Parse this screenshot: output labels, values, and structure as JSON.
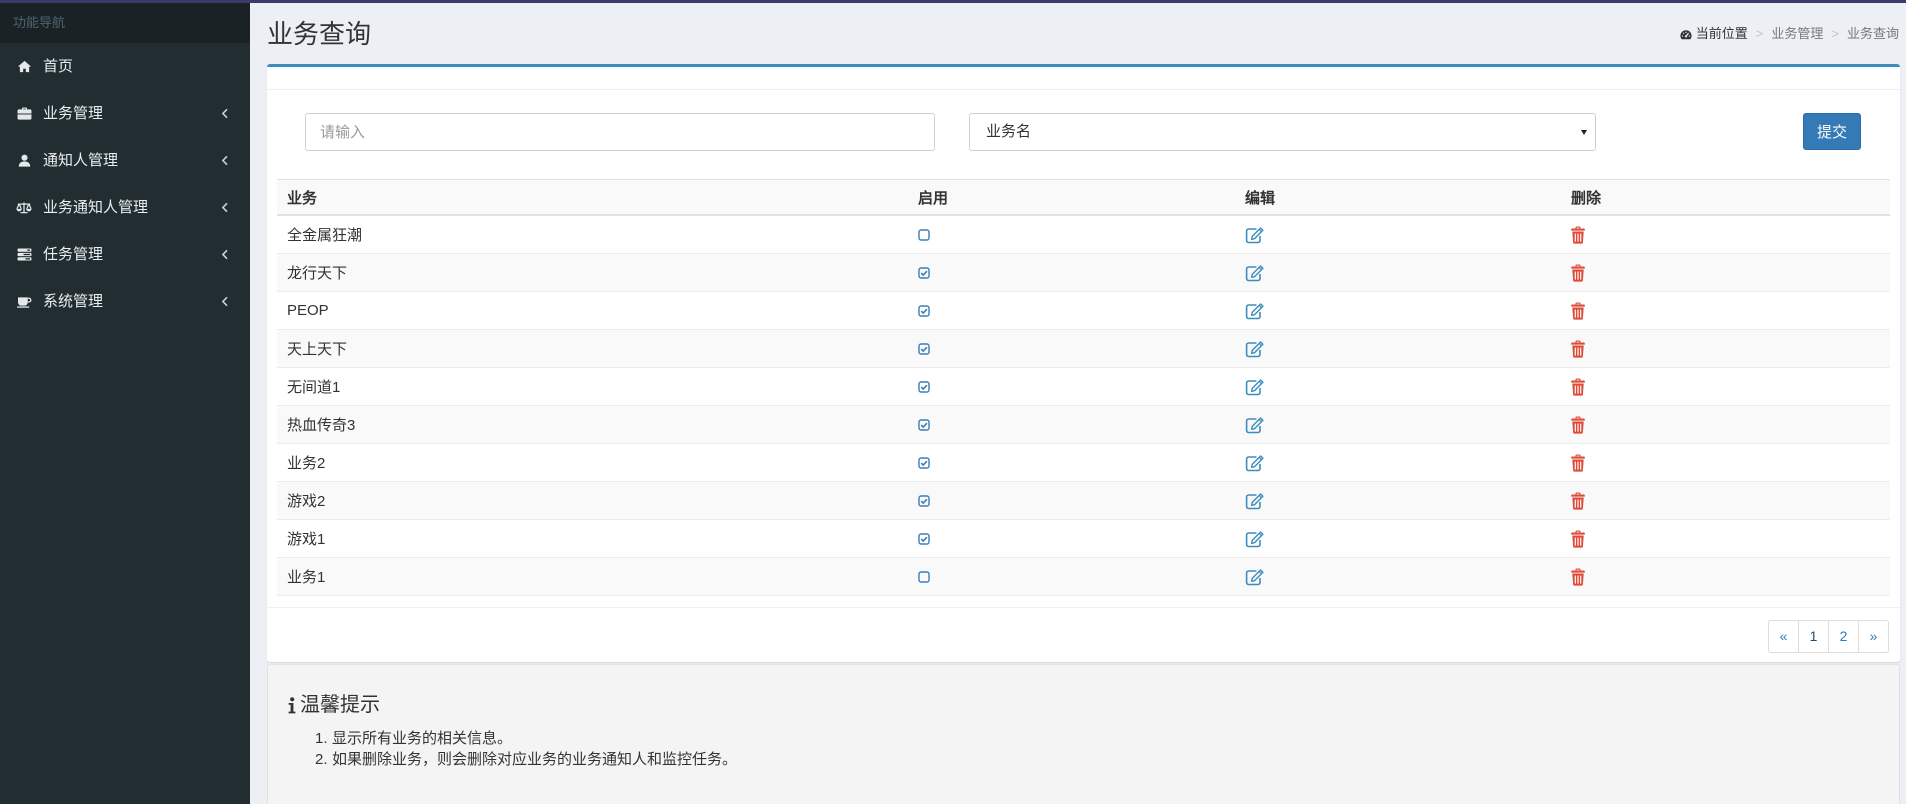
{
  "colors": {
    "top_bar": "#3b3a6e",
    "sidebar_bg": "#222d32",
    "sidebar_header_bg": "#1a2226",
    "main_bg": "#ecf0f5",
    "accent": "#3c8dbc",
    "primary_button": "#337ab7",
    "danger": "#dd4b39"
  },
  "sidebar": {
    "header": "功能导航",
    "items": [
      {
        "label": "首页",
        "icon": "home-icon",
        "has_submenu": false
      },
      {
        "label": "业务管理",
        "icon": "briefcase-icon",
        "has_submenu": true
      },
      {
        "label": "通知人管理",
        "icon": "user-icon",
        "has_submenu": true
      },
      {
        "label": "业务通知人管理",
        "icon": "balance-scale-icon",
        "has_submenu": true
      },
      {
        "label": "任务管理",
        "icon": "tasks-icon",
        "has_submenu": true
      },
      {
        "label": "系统管理",
        "icon": "coffee-icon",
        "has_submenu": true
      }
    ]
  },
  "page": {
    "title": "业务查询"
  },
  "breadcrumb": {
    "icon": "dashboard-icon",
    "separator": ">",
    "items": [
      "当前位置",
      "业务管理",
      "业务查询"
    ]
  },
  "search": {
    "input_placeholder": "请输入",
    "select_value": "业务名",
    "submit_label": "提交"
  },
  "table": {
    "columns": [
      "业务",
      "启用",
      "编辑",
      "删除"
    ],
    "rows": [
      {
        "name": "全金属狂潮",
        "enabled": false
      },
      {
        "name": "龙行天下",
        "enabled": true
      },
      {
        "name": "PEOP",
        "enabled": true
      },
      {
        "name": "天上天下",
        "enabled": true
      },
      {
        "name": "无间道1",
        "enabled": true
      },
      {
        "name": "热血传奇3",
        "enabled": true
      },
      {
        "name": "业务2",
        "enabled": true
      },
      {
        "name": "游戏2",
        "enabled": true
      },
      {
        "name": "游戏1",
        "enabled": true
      },
      {
        "name": "业务1",
        "enabled": false
      }
    ]
  },
  "pagination": {
    "prev": "«",
    "pages": [
      "1",
      "2"
    ],
    "current": "1",
    "next": "»"
  },
  "tips": {
    "title": "温馨提示",
    "items": [
      {
        "num": "1.",
        "text": "显示所有业务的相关信息。"
      },
      {
        "num": "2.",
        "text": "如果删除业务，则会删除对应业务的业务通知人和监控任务。"
      }
    ]
  }
}
